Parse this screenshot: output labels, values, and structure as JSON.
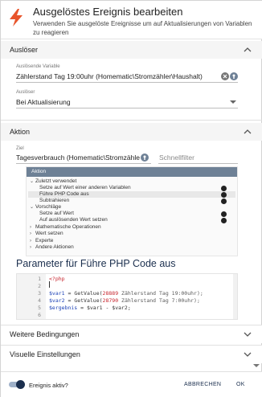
{
  "header": {
    "title": "Ausgelöstes Ereignis bearbeiten",
    "subtitle": "Verwenden Sie ausgelöste Ereignisse um auf Aktualisierungen von Variablen zu reagieren",
    "icon": "lightning-bolt-icon",
    "accent": "#e8542b"
  },
  "trigger_section": {
    "label": "Auslöser",
    "variable_label": "Auslösende Variable",
    "variable_value": "Zählerstand Tag 19:00uhr (Homematic\\Stromzähler\\Haushalt)",
    "trigger_label": "Auslöser",
    "trigger_value": "Bei Aktualisierung"
  },
  "action_section": {
    "label": "Aktion",
    "target_label": "Ziel",
    "target_value": "Tagesverbrauch (Homematic\\Stromzähler\\Ha",
    "quickfilter_placeholder": "Schnellfilter",
    "tree_header": "Aktion",
    "tree": {
      "recent": "Zuletzt verwendet",
      "recent_items": [
        "Setze auf Wert einer anderen Variablen",
        "Führe PHP Code aus",
        "Subtrahieren"
      ],
      "suggestions": "Vorschläge",
      "suggestion_items": [
        "Setze auf Wert",
        "Auf auslösenden Wert setzen"
      ],
      "groups": [
        "Mathematische Operationen",
        "Wert setzen",
        "Experte",
        "Andere Aktionen"
      ]
    },
    "params_title": "Parameter für Führe PHP Code aus",
    "code_lines": [
      {
        "n": "1",
        "text": "<?php"
      },
      {
        "n": "2",
        "text": ""
      },
      {
        "n": "3",
        "var": "$var1",
        "rest": " = GetValue(",
        "num": "28889",
        "cmt": " Zählerstand Tag 19:00uhr);"
      },
      {
        "n": "4",
        "var": "$var2",
        "rest": " = GetValue(",
        "num": "28790",
        "cmt": " Zählerstand Tag 7:00uhr);"
      },
      {
        "n": "5",
        "var": "$ergebnis",
        "rest": " = $var1 - $var2;"
      },
      {
        "n": "6",
        "text": ""
      }
    ]
  },
  "more_conditions": {
    "label": "Weitere Bedingungen"
  },
  "visual_settings": {
    "label": "Visuelle Einstellungen"
  },
  "footer": {
    "active_label": "Ereignis aktiv?",
    "active": true,
    "cancel": "ABBRECHEN",
    "ok": "OK"
  }
}
